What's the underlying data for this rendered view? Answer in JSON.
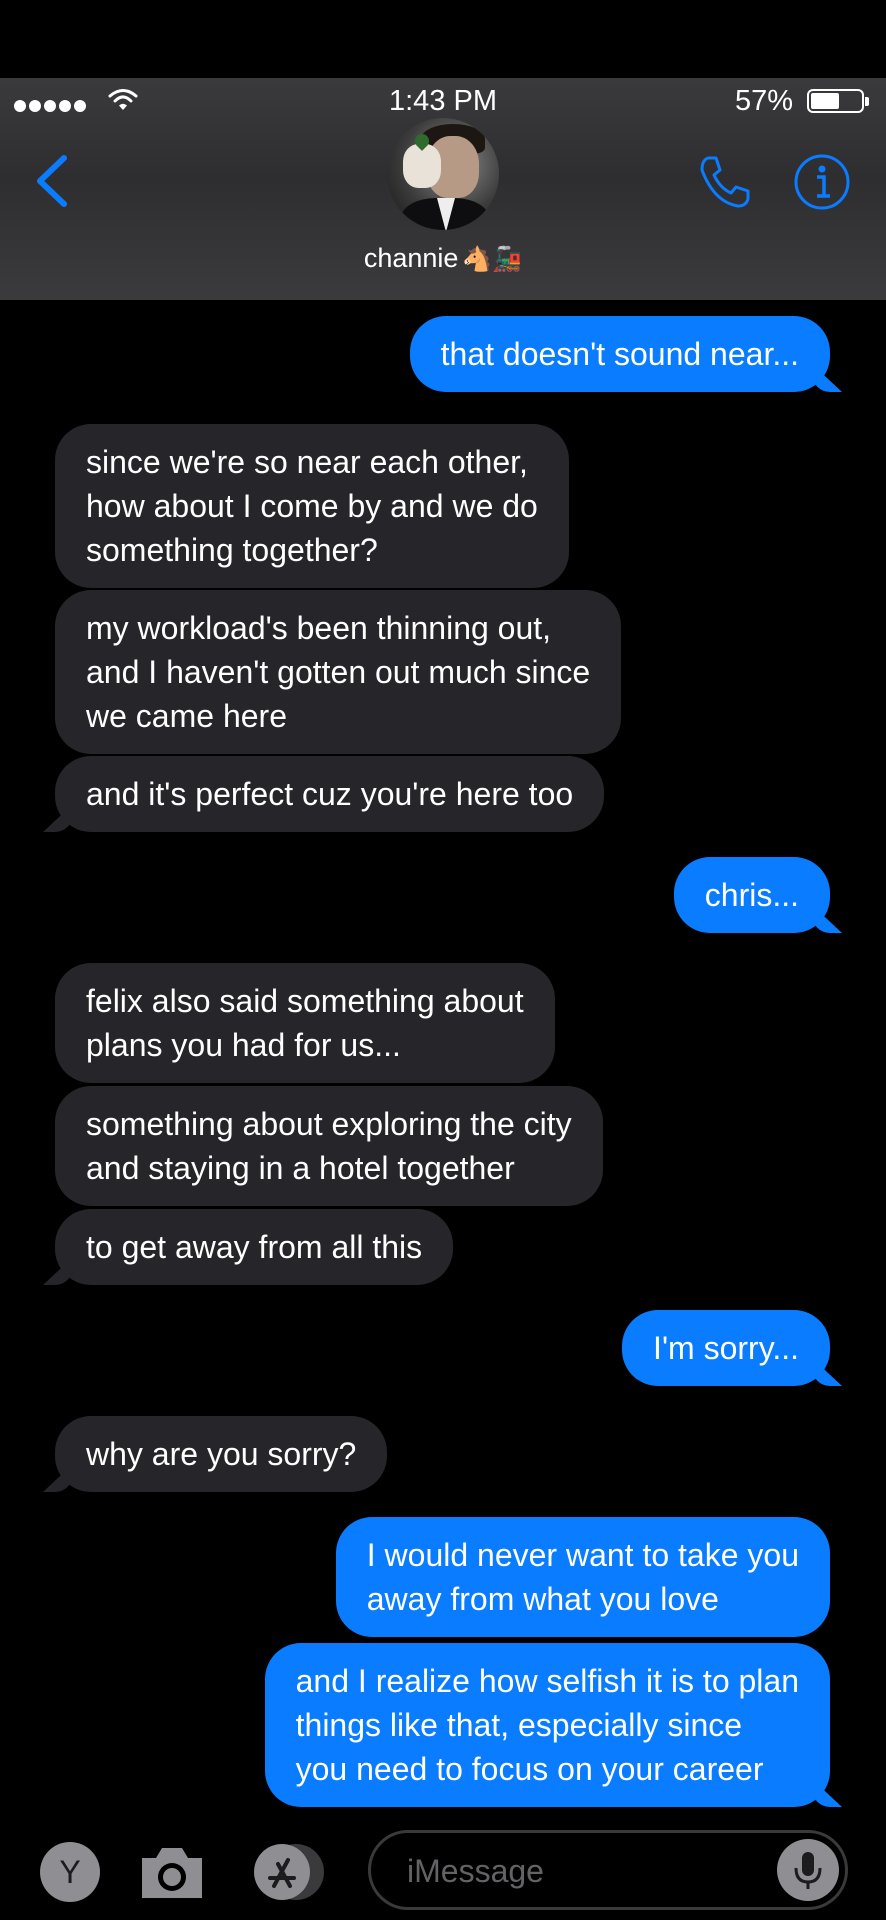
{
  "status_bar": {
    "time": "1:43 PM",
    "battery_percent": "57%",
    "battery_level": 0.57,
    "signal_bars": 5
  },
  "header": {
    "back_icon": "chevron-left-icon",
    "contact_name": "channie",
    "contact_emoji": "🐴🚂",
    "call_icon": "phone-icon",
    "info_icon": "info-icon"
  },
  "messages": [
    {
      "direction": "outgoing",
      "text": "that doesn't sound near..."
    },
    {
      "direction": "incoming",
      "text": "since we're so near each other,\nhow about I come by and we do\nsomething together?"
    },
    {
      "direction": "incoming",
      "text": "my workload's been thinning out,\nand I haven't gotten out much since\nwe came here"
    },
    {
      "direction": "incoming",
      "text": "and it's perfect cuz you're here too"
    },
    {
      "direction": "outgoing",
      "text": "chris..."
    },
    {
      "direction": "incoming",
      "text": "felix also said something about\nplans you had for us..."
    },
    {
      "direction": "incoming",
      "text": "something about exploring the city\nand staying in a hotel together"
    },
    {
      "direction": "incoming",
      "text": "to get away from all this"
    },
    {
      "direction": "outgoing",
      "text": "I'm sorry..."
    },
    {
      "direction": "incoming",
      "text": "why are you sorry?"
    },
    {
      "direction": "outgoing",
      "text": "I would never want to take you\naway from what you love"
    },
    {
      "direction": "outgoing",
      "text": "and I realize how selfish it is to plan\nthings like that, especially since\nyou need to focus on your career"
    }
  ],
  "composer": {
    "app_button_label": "Y",
    "camera_icon": "camera-icon",
    "appstore_icon": "appstore-icon",
    "placeholder": "iMessage",
    "mic_icon": "microphone-icon"
  },
  "colors": {
    "outgoing_bubble": "#0a7cff",
    "incoming_bubble": "#262529",
    "accent": "#0a7cff",
    "background": "#000000"
  }
}
